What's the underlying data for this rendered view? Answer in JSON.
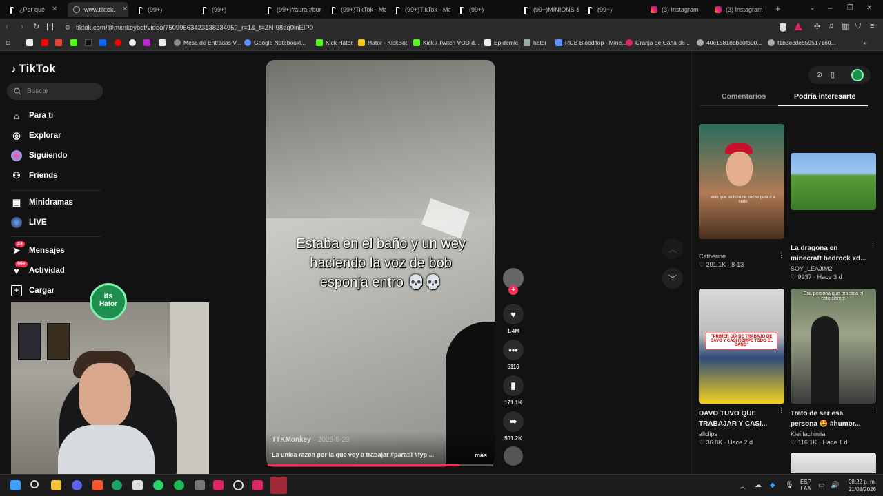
{
  "tabs": [
    {
      "label": "¿Por qué",
      "icon": "tiktok",
      "active": false
    },
    {
      "label": "www.tiktok.",
      "icon": "globe",
      "active": true
    },
    {
      "label": "(99+)",
      "icon": "tiktok",
      "active": false
    },
    {
      "label": "(99+)",
      "icon": "tiktok",
      "active": false
    },
    {
      "label": "(99+)#aura #bur",
      "icon": "tiktok",
      "active": false
    },
    {
      "label": "(99+)TikTok - Ma",
      "icon": "tiktok",
      "active": false
    },
    {
      "label": "(99+)TikTok - Ma",
      "icon": "tiktok",
      "active": false
    },
    {
      "label": "(99+)",
      "icon": "tiktok",
      "active": false
    },
    {
      "label": "(99+)MINIONS &",
      "icon": "tiktok",
      "active": false
    },
    {
      "label": "(99+)",
      "icon": "tiktok",
      "active": false
    },
    {
      "label": "(3) Instagram",
      "icon": "instagram",
      "active": false
    },
    {
      "label": "(3) Instagram",
      "icon": "instagram",
      "active": false
    }
  ],
  "address": {
    "url": "tiktok.com/@mxnkeybot/video/7509966342313823495?_r=1&_t=ZN-98dq0lnEIP0"
  },
  "bookmarks": [
    "Mesa de Entradas V...",
    "Google Notebookl...",
    "Kick Hator",
    "Hator - KickBot",
    "Kick / Twitch VOD d...",
    "Epidemic",
    "hator",
    "RGB Bloodflop - Mine...",
    "Granja de Caña de...",
    "40e15818bbe0fb90...",
    "f1b3ecde859517160..."
  ],
  "sidebar": {
    "logo": "TikTok",
    "search_placeholder": "Buscar",
    "items": [
      {
        "label": "Para ti",
        "icon": "home-icon"
      },
      {
        "label": "Explorar",
        "icon": "compass-icon"
      },
      {
        "label": "Siguiendo",
        "icon": "following-icon"
      },
      {
        "label": "Friends",
        "icon": "friends-icon"
      },
      {
        "label": "Minidramas",
        "icon": "film-icon"
      },
      {
        "label": "LIVE",
        "icon": "live-icon"
      },
      {
        "label": "Mensajes",
        "icon": "message-icon",
        "badge": "43"
      },
      {
        "label": "Actividad",
        "icon": "activity-icon",
        "badge": "99+"
      },
      {
        "label": "Cargar",
        "icon": "upload-icon"
      }
    ]
  },
  "overlay": {
    "badge_line1": "its",
    "badge_line2": "Hator"
  },
  "video": {
    "caption": "Estaba en el baño y un wey haciendo la voz de bob esponja entro 💀💀",
    "author": "TTKMonkey",
    "date": "· 2025-5-29",
    "description": "La unica razon por la que voy a trabajar #paratii #fyp ...",
    "more": "más",
    "likes": "1.4M",
    "comments": "5116",
    "saves": "171.1K",
    "shares": "501.2K"
  },
  "right_panel": {
    "tab_comments": "Comentarios",
    "tab_interest": "Podría interesarte",
    "cards": [
      {
        "title": "",
        "user": "Catherine",
        "likes": "201.1K",
        "time": "8-13",
        "thumb_text": "este que se hizo de coche para ir a verlo"
      },
      {
        "title": "La dragona en minecraft bedrock xd...",
        "user": "SOY_LEAJIM2",
        "likes": "9937",
        "time": "Hace 3 d",
        "thumb_text": ""
      },
      {
        "title": "DAVO TUVO QUE TRABAJAR Y CASI...",
        "user": "allclips",
        "likes": "36.8K",
        "time": "Hace 2 d",
        "thumb_text": "\"PRIMER DÍA DE TRABAJO DE DAVO Y CASI ROMPE TODO EL BAÑO\""
      },
      {
        "title": "Trato de ser esa persona 🤩 #humor...",
        "user": "Klei.lachinita",
        "likes": "116.1K",
        "time": "Hace 1 d",
        "thumb_text": "Esa persona que practica el estoicismo:"
      }
    ]
  },
  "taskbar": {
    "lang1": "ESP",
    "lang2": "LAA",
    "time": "08:22 p. m.",
    "date": "21/08/2026"
  }
}
